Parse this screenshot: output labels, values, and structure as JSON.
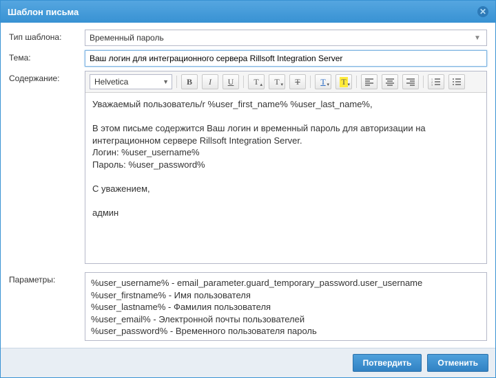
{
  "dialog": {
    "title": "Шаблон письма"
  },
  "labels": {
    "type": "Тип шаблона:",
    "subject": "Тема:",
    "content": "Содержание:",
    "params": "Параметры:"
  },
  "fields": {
    "type_value": "Временный пароль",
    "subject_value": "Ваш логин для интеграционного сервера Rillsoft Integration Server",
    "font_value": "Helvetica"
  },
  "editor_body": "Уважаемый пользователь/r %user_first_name% %user_last_name%,\n\nВ этом письме содержится Ваш логин и временный пароль для авторизации на интеграционном сервере Rillsoft Integration Server.\nЛогин: %user_username%\nПароль: %user_password%\n\nС уважением,\n\nадмин",
  "params_lines": [
    "%user_username% - email_parameter.guard_temporary_password.user_username",
    "%user_firstname% - Имя пользователя",
    "%user_lastname% - Фамилия пользователя",
    "%user_email% - Электронной почты пользователей",
    "%user_password% - Временного пользователя пароль"
  ],
  "buttons": {
    "confirm": "Потвердить",
    "cancel": "Отменить"
  },
  "toolbar": {
    "bold": "B",
    "italic": "I",
    "underline": "U",
    "size_up": "T",
    "size_down": "T",
    "strike": "T",
    "forecolor": "T",
    "backcolor": "T"
  }
}
